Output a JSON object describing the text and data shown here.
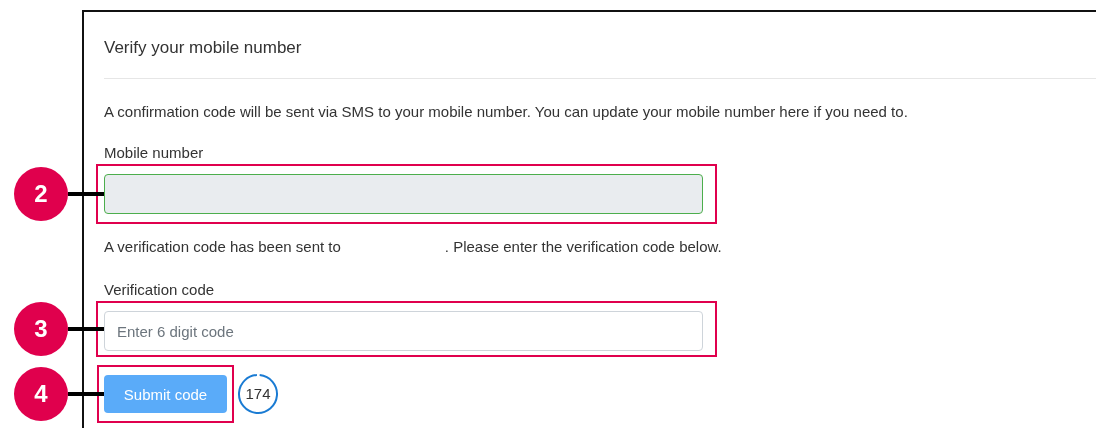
{
  "title": "Verify your mobile number",
  "intro": "A confirmation code will be sent via SMS to your mobile number. You can update your mobile number here if you need to.",
  "mobile_field": {
    "label": "Mobile number",
    "disabled": true,
    "valid": true,
    "callout": "2"
  },
  "sent_message": {
    "before": "A verification code has been sent to",
    "after": ". Please enter the verification code below."
  },
  "code_field": {
    "label": "Verification code",
    "placeholder": "Enter 6 digit code",
    "callout": "3"
  },
  "submit_button": {
    "label": "Submit code",
    "disabled": true,
    "callout": "4"
  },
  "countdown": {
    "value": "174"
  }
}
